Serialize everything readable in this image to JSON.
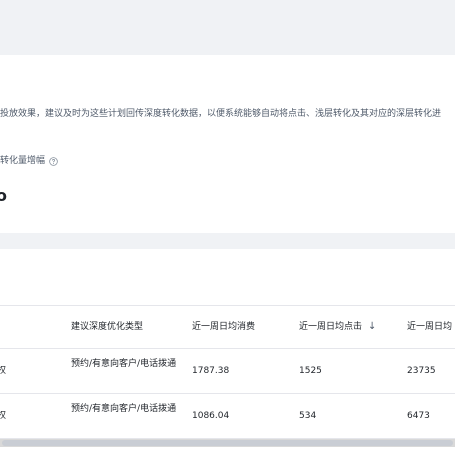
{
  "notice": {
    "text": "投放效果，建议及时为这些计划回传深度转化数据，以便系统能够自动将点击、浅层转化及其对应的深层转化进"
  },
  "metric": {
    "label": "转化量增幅",
    "value": "o"
  },
  "table": {
    "headers": [
      "建议深度优化类型",
      "近一周日均消费",
      "近一周日均点击",
      "近一周日均"
    ],
    "sort_icon": "↓",
    "rows": [
      {
        "lead": "权",
        "type": "预约/有意向客户/电话拨通",
        "spend": "1787.38",
        "clicks": "1525",
        "last": "23735"
      },
      {
        "lead": "权",
        "type": "预约/有意向客户/电话拨通",
        "spend": "1086.04",
        "clicks": "534",
        "last": "6473"
      }
    ]
  },
  "icons": {
    "help": "question-circle-icon",
    "sort": "arrow-down-icon"
  },
  "colors": {
    "background": "#f0f2f5",
    "card": "#ffffff",
    "border": "#e5e6eb",
    "text": "#1f2329",
    "muted": "#4e5969"
  }
}
